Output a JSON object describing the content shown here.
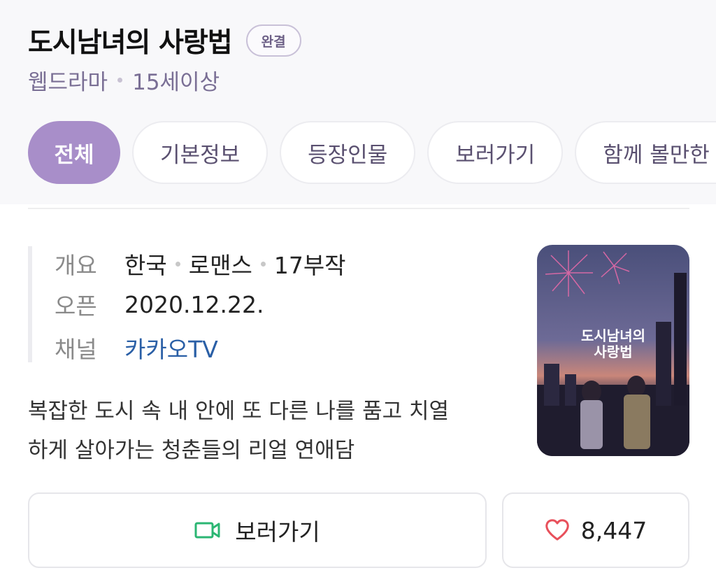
{
  "header": {
    "title": "도시남녀의 사랑법",
    "status_badge": "완결",
    "genre": "웹드라마",
    "rating": "15세이상"
  },
  "tabs": [
    {
      "label": "전체",
      "active": true
    },
    {
      "label": "기본정보",
      "active": false
    },
    {
      "label": "등장인물",
      "active": false
    },
    {
      "label": "보러가기",
      "active": false
    },
    {
      "label": "함께 볼만한 웹",
      "active": false
    }
  ],
  "info": {
    "overview_label": "개요",
    "country": "한국",
    "genre": "로맨스",
    "episodes": "17부작",
    "open_label": "오픈",
    "open_date": "2020.12.22.",
    "channel_label": "채널",
    "channel": "카카오TV"
  },
  "synopsis": {
    "line1": "복잡한 도시 속 내 안에 또 다른 나를 품고 치열",
    "line2": "하게 살아가는 청춘들의 리얼 연애담"
  },
  "poster": {
    "title_line1": "도시남녀의",
    "title_line2": "사랑법"
  },
  "actions": {
    "watch_label": "보러가기",
    "watch_icon": "video-camera-icon",
    "like_count": "8,447",
    "like_icon": "heart-icon"
  },
  "colors": {
    "accent": "#a88ec9",
    "badge_text": "#6c5f86",
    "link": "#2a5fa6",
    "watch_icon": "#2bb673",
    "heart": "#e8505b"
  }
}
